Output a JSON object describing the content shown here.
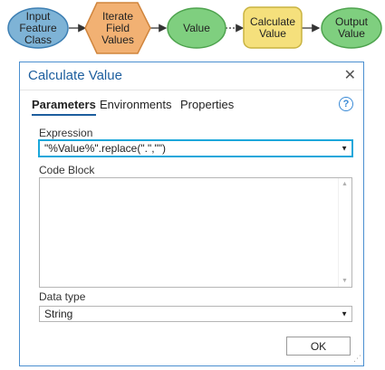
{
  "model": {
    "nodes": [
      {
        "label": "Input\nFeature\nClass"
      },
      {
        "label": "Iterate\nField\nValues"
      },
      {
        "label": "Value"
      },
      {
        "label": "Calculate\nValue"
      },
      {
        "label": "Output\nValue"
      }
    ],
    "colors": {
      "input_fill": "#7eb3d6",
      "input_stroke": "#3d7fb3",
      "iterator_fill": "#f2b173",
      "iterator_stroke": "#d0853d",
      "variable_fill": "#7fcf7f",
      "variable_stroke": "#4ea34e",
      "tool_fill": "#f5e07c",
      "tool_stroke": "#c9b340"
    }
  },
  "dialog": {
    "title": "Calculate Value",
    "close_icon": "close-icon",
    "tabs": [
      "Parameters",
      "Environments",
      "Properties"
    ],
    "help_icon": "?",
    "expression_label": "Expression",
    "expression_value": "\"%Value%\".replace(\".\",\"\")",
    "code_block_label": "Code Block",
    "code_block_value": "",
    "data_type_label": "Data type",
    "data_type_value": "String",
    "ok_label": "OK"
  }
}
